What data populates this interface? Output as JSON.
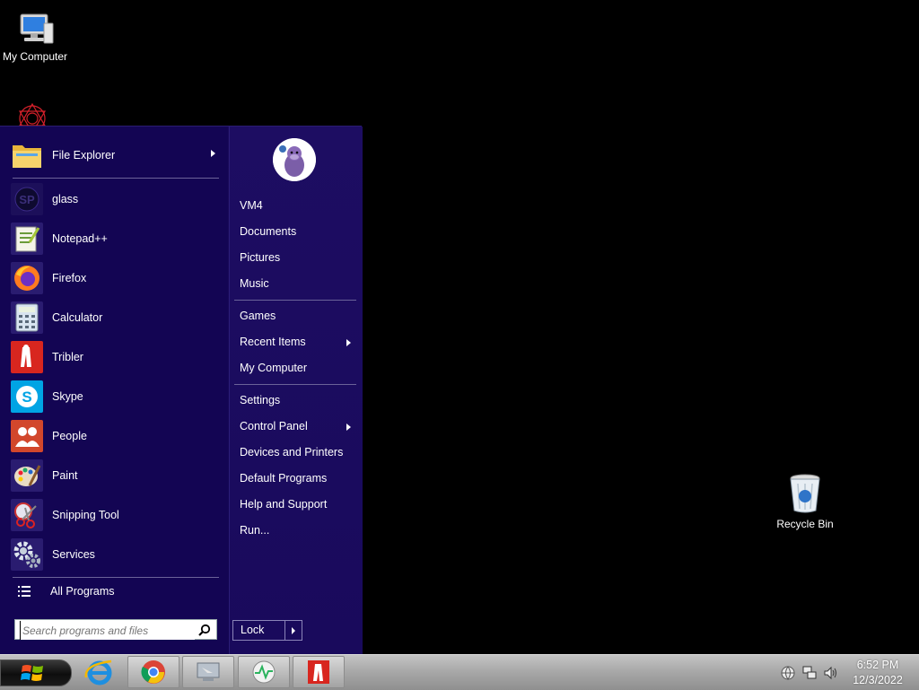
{
  "desktop": {
    "icons": [
      {
        "label": "My Computer",
        "icon": "computer-icon"
      },
      {
        "label": "Recycle Bin",
        "icon": "recycle-bin-icon"
      }
    ]
  },
  "start_menu": {
    "apps": [
      {
        "label": "File Explorer",
        "icon": "folder-icon",
        "has_submenu": true
      },
      {
        "label": "glass",
        "icon": "glass-sp-icon"
      },
      {
        "label": "Notepad++",
        "icon": "notepad-icon"
      },
      {
        "label": "Firefox",
        "icon": "firefox-icon"
      },
      {
        "label": "Calculator",
        "icon": "calculator-icon"
      },
      {
        "label": "Tribler",
        "icon": "tribler-icon"
      },
      {
        "label": "Skype",
        "icon": "skype-icon"
      },
      {
        "label": "People",
        "icon": "people-icon"
      },
      {
        "label": "Paint",
        "icon": "paint-icon"
      },
      {
        "label": "Snipping Tool",
        "icon": "snipping-tool-icon"
      },
      {
        "label": "Services",
        "icon": "gear-icon"
      }
    ],
    "all_programs": "All Programs",
    "search": {
      "placeholder": "Search programs and files"
    },
    "places": [
      {
        "label": "VM4"
      },
      {
        "label": "Documents"
      },
      {
        "label": "Pictures"
      },
      {
        "label": "Music"
      },
      {
        "label": "Games"
      },
      {
        "label": "Recent Items",
        "has_submenu": true
      },
      {
        "label": "My Computer"
      },
      {
        "label": "Settings"
      },
      {
        "label": "Control Panel",
        "has_submenu": true
      },
      {
        "label": "Devices and Printers"
      },
      {
        "label": "Default Programs"
      },
      {
        "label": "Help and Support"
      },
      {
        "label": "Run..."
      }
    ],
    "power_button": "Lock"
  },
  "taskbar": {
    "pinned": [
      "internet-explorer-icon",
      "chrome-icon",
      "remote-desktop-icon",
      "health-monitor-icon",
      "tribler-icon"
    ],
    "clock": {
      "time": "6:52 PM",
      "date": "12/3/2022"
    }
  },
  "colors": {
    "menu_bg": "#130553",
    "separator": "#6b6399",
    "taskbar": "#a9a9a9"
  }
}
